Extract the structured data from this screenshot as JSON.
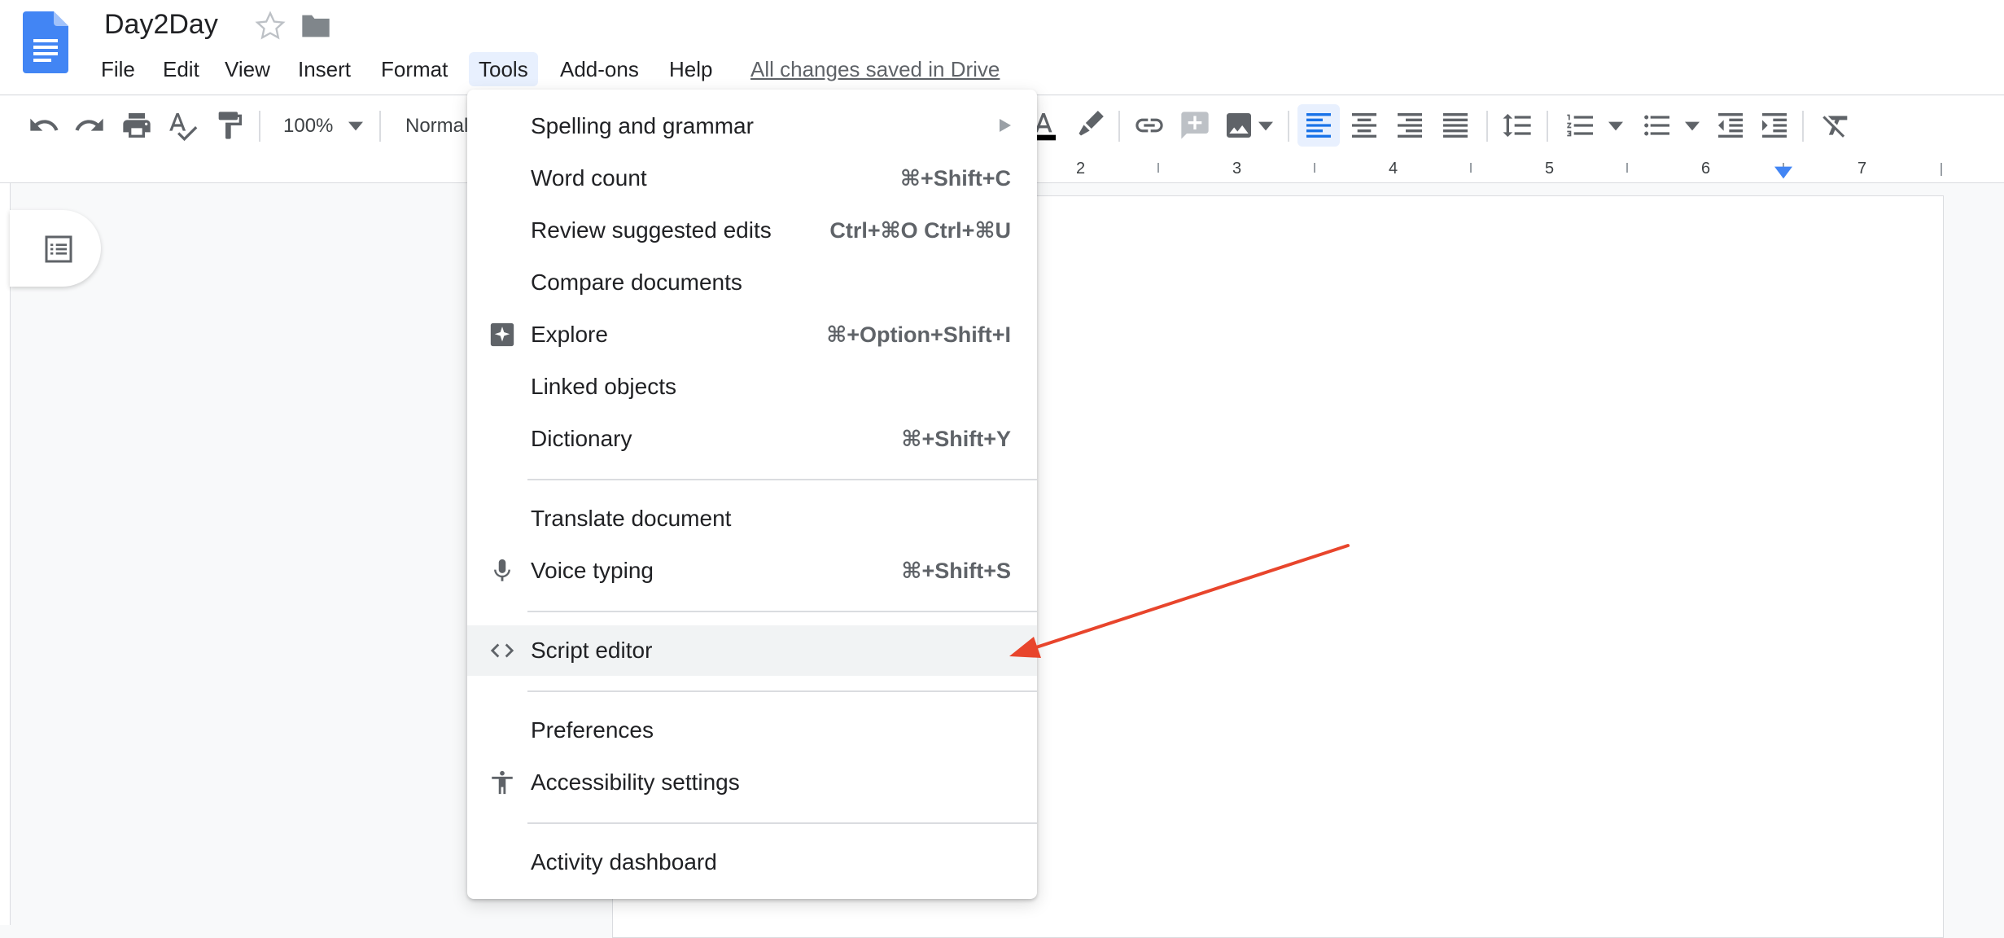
{
  "header": {
    "doc_title": "Day2Day",
    "menu": [
      "File",
      "Edit",
      "View",
      "Insert",
      "Format",
      "Tools",
      "Add-ons",
      "Help"
    ],
    "save_status": "All changes saved in Drive"
  },
  "toolbar": {
    "zoom": "100%",
    "style": "Normal"
  },
  "ruler": {
    "labels": [
      "2",
      "3",
      "4",
      "5",
      "6",
      "7"
    ]
  },
  "tools_menu": {
    "items": [
      {
        "label": "Spelling and grammar",
        "shortcut": "",
        "icon": "",
        "submenu": true
      },
      {
        "label": "Word count",
        "shortcut": "⌘+Shift+C",
        "icon": ""
      },
      {
        "label": "Review suggested edits",
        "shortcut": "Ctrl+⌘O Ctrl+⌘U",
        "icon": ""
      },
      {
        "label": "Compare documents",
        "shortcut": "",
        "icon": ""
      },
      {
        "label": "Explore",
        "shortcut": "⌘+Option+Shift+I",
        "icon": "explore-icon"
      },
      {
        "label": "Linked objects",
        "shortcut": "",
        "icon": ""
      },
      {
        "label": "Dictionary",
        "shortcut": "⌘+Shift+Y",
        "icon": ""
      },
      {
        "label": "Translate document",
        "shortcut": "",
        "icon": ""
      },
      {
        "label": "Voice typing",
        "shortcut": "⌘+Shift+S",
        "icon": "microphone-icon"
      },
      {
        "label": "Script editor",
        "shortcut": "",
        "icon": "code-icon",
        "highlighted": true
      },
      {
        "label": "Preferences",
        "shortcut": "",
        "icon": ""
      },
      {
        "label": "Accessibility settings",
        "shortcut": "",
        "icon": "accessibility-icon"
      },
      {
        "label": "Activity dashboard",
        "shortcut": "",
        "icon": ""
      }
    ]
  },
  "colors": {
    "accent": "#1a73e8",
    "annotation_arrow": "#e8452c",
    "docs_blue": "#4285f4"
  }
}
